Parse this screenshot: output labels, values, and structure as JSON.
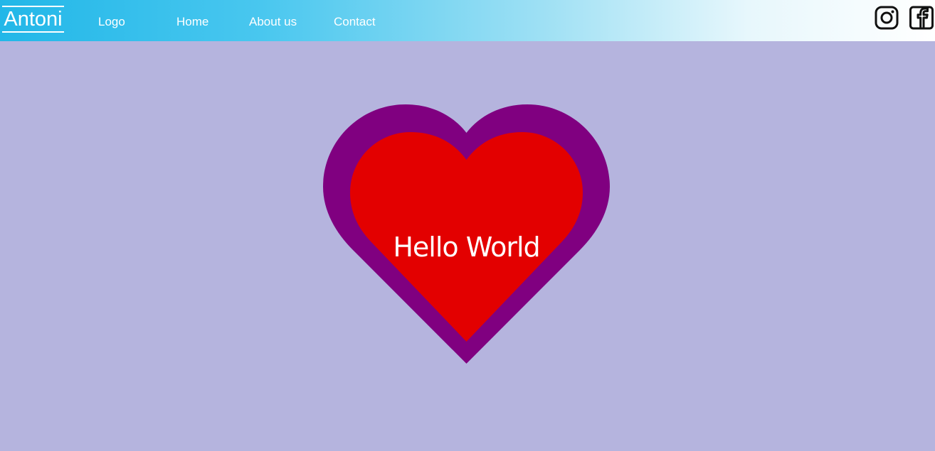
{
  "header": {
    "brand": "Antoni",
    "nav": {
      "logo": "Logo",
      "home": "Home",
      "about": "About us",
      "contact": "Contact"
    },
    "social": {
      "instagram_icon": "instagram-icon",
      "facebook_icon": "facebook-icon"
    }
  },
  "main": {
    "headline": "Hello World"
  },
  "colors": {
    "header_gradient_start": "#22b7e8",
    "header_gradient_end": "#ffffff",
    "page_background": "#b5b4de",
    "heart_outer": "#800080",
    "heart_inner": "#e30000",
    "text_light": "#ffffff",
    "icon_dark": "#111111"
  }
}
